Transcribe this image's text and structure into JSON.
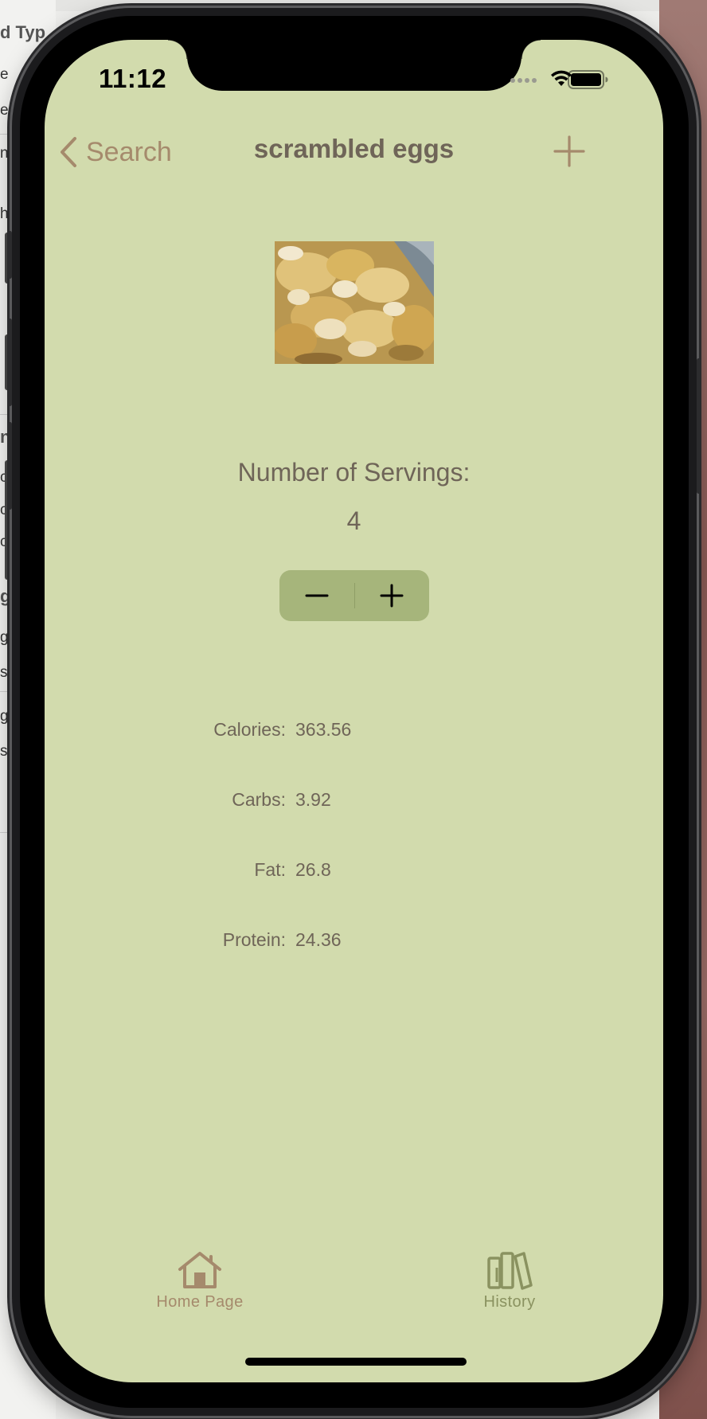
{
  "status_bar": {
    "time": "11:12"
  },
  "background_app": {
    "left_fragments": [
      "d Typ",
      "e",
      "e",
      "n",
      "h",
      "n",
      "c",
      "c",
      "c",
      "gs",
      "g",
      "s",
      "g",
      "s"
    ]
  },
  "nav": {
    "back_label": "Search",
    "title": "scrambled eggs",
    "add_icon": "plus-icon"
  },
  "food": {
    "image_icon": "scrambled-eggs-photo"
  },
  "servings": {
    "label": "Number of Servings:",
    "value": "4",
    "decrement_icon": "minus-icon",
    "increment_icon": "plus-icon"
  },
  "nutrition": [
    {
      "label": "Calories:",
      "value": "363.56"
    },
    {
      "label": "Carbs:",
      "value": "3.92"
    },
    {
      "label": "Fat:",
      "value": "26.8"
    },
    {
      "label": "Protein:",
      "value": "24.36"
    }
  ],
  "tabs": [
    {
      "label": "Home Page",
      "icon": "house-icon"
    },
    {
      "label": "History",
      "icon": "books-icon"
    }
  ],
  "colors": {
    "screen_background": "#d2dbad",
    "accent_brown": "#a58a6c",
    "text": "#6f6558",
    "stepper_background": "#a6b57b",
    "history_tab": "#8a9260"
  }
}
